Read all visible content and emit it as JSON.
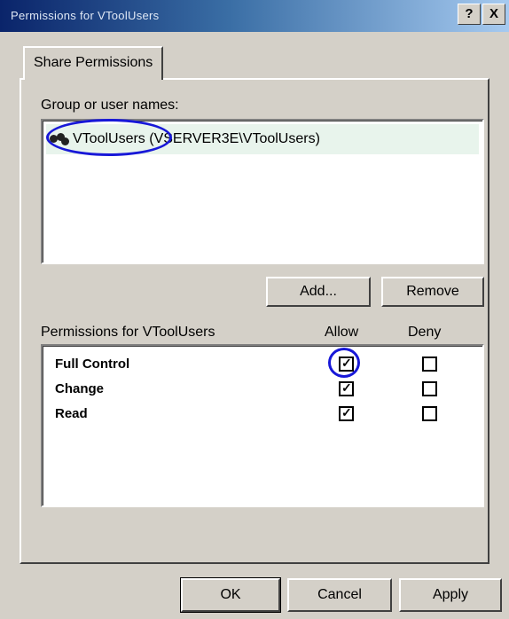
{
  "window": {
    "title": "Permissions for VToolUsers",
    "help_button": "?",
    "close_button": "X"
  },
  "tab": {
    "label": "Share Permissions"
  },
  "group_section": {
    "label": "Group or user names:",
    "users": [
      {
        "name": "VToolUsers (VSERVER3E\\VToolUsers)"
      }
    ],
    "add_label": "Add...",
    "remove_label": "Remove"
  },
  "permissions_section": {
    "label": "Permissions for VToolUsers",
    "allow_header": "Allow",
    "deny_header": "Deny",
    "rows": [
      {
        "name": "Full Control",
        "allow": true,
        "deny": false
      },
      {
        "name": "Change",
        "allow": true,
        "deny": false
      },
      {
        "name": "Read",
        "allow": true,
        "deny": false
      }
    ]
  },
  "footer": {
    "ok_label": "OK",
    "cancel_label": "Cancel",
    "apply_label": "Apply"
  },
  "colors": {
    "highlight_annotation": "#1818d8",
    "dialog_bg": "#d4d0c8",
    "titlebar_start": "#0a246a"
  },
  "icons": {
    "user_group": "users-icon",
    "checkbox": "checkbox-icon"
  }
}
